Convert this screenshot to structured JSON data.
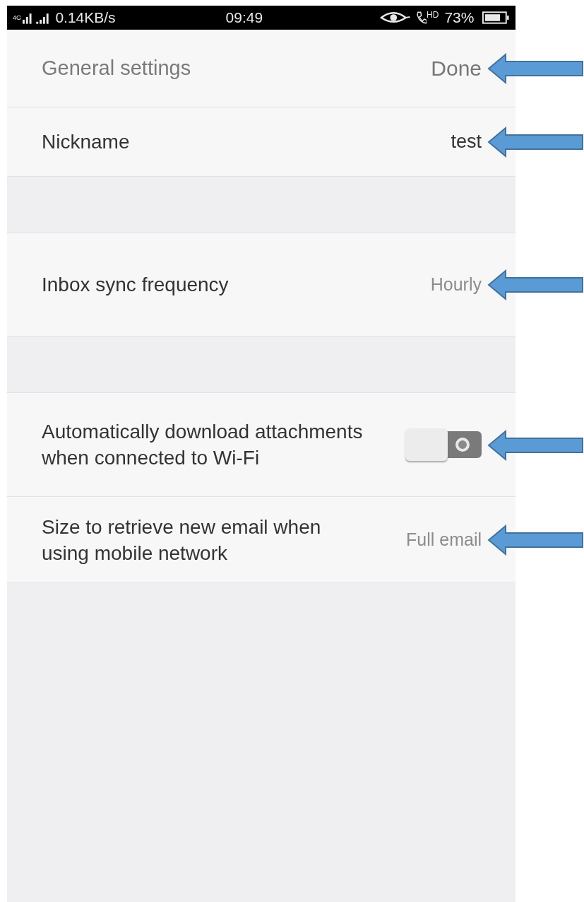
{
  "status_bar": {
    "network": "4G",
    "speed": "0.14KB/s",
    "time": "09:49",
    "call_badge": "HD",
    "battery": "73%"
  },
  "items": [
    {
      "kind": "header",
      "label": "General settings",
      "value": "Done",
      "arrow": true
    },
    {
      "kind": "row",
      "label": "Nickname",
      "value": "test",
      "muted": false,
      "arrow": true
    },
    {
      "kind": "gap"
    },
    {
      "kind": "row",
      "label": "Inbox sync frequency",
      "value": "Hourly",
      "muted": true,
      "arrow": true
    },
    {
      "kind": "gap"
    },
    {
      "kind": "toggle",
      "label": "Automatically download attachments when connected to Wi-Fi",
      "on": false,
      "arrow": true
    },
    {
      "kind": "row",
      "label": "Size to retrieve new email when using mobile network",
      "value": "Full email",
      "muted": true,
      "arrow": true
    }
  ]
}
